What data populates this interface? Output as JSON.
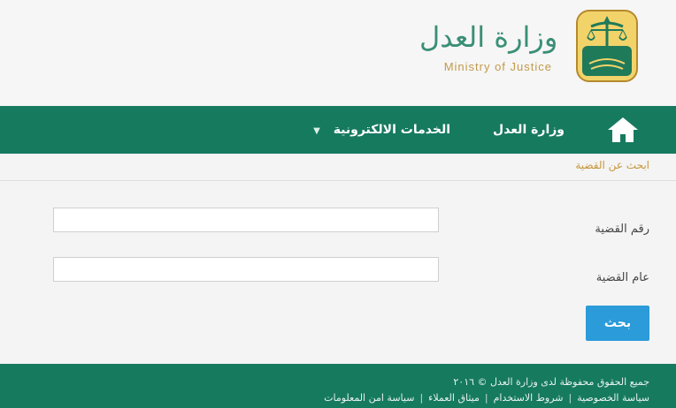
{
  "header": {
    "logo_ar": "وزارة العدل",
    "logo_en": "Ministry of Justice"
  },
  "nav": {
    "home_icon": "home-icon",
    "items": [
      {
        "label": "وزارة العدل"
      },
      {
        "label": "الخدمات الالكترونية"
      }
    ]
  },
  "breadcrumb": {
    "label": "ابحث عن القضية"
  },
  "form": {
    "case_number_label": "رقم القضية",
    "case_year_label": "عام القضية",
    "case_number_value": "",
    "case_year_value": "",
    "search_label": "بحث"
  },
  "footer": {
    "copyright": "جميع الحقوق محفوظة لدى وزارة العدل © ٢٠١٦",
    "links": [
      {
        "label": "سياسة الخصوصية"
      },
      {
        "label": "شروط الاستخدام"
      },
      {
        "label": "ميثاق العملاء"
      },
      {
        "label": "سياسة امن المعلومات"
      }
    ]
  },
  "colors": {
    "primary_green": "#167a5f",
    "accent_gold": "#c8963b",
    "button_blue": "#2b9bd9"
  }
}
